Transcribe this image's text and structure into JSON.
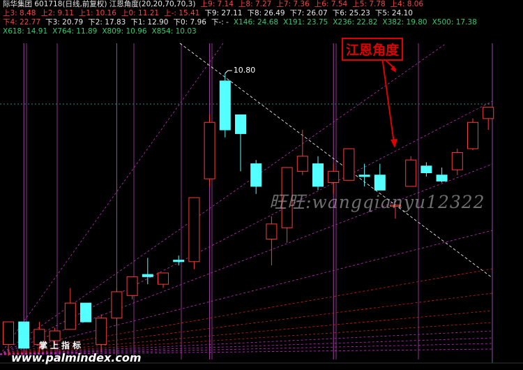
{
  "header": {
    "row1": [
      {
        "text": "际华集团 601718(日线,前复权) 江恩角度(20,20,70,70,3)",
        "color": "#e8e8e8"
      },
      {
        "text": "上9: 7.14",
        "color": "#ff4040"
      },
      {
        "text": "上8: 7.27",
        "color": "#ff4040"
      },
      {
        "text": "上7: 7.36",
        "color": "#ff4040"
      },
      {
        "text": "上6: 7.54",
        "color": "#ff4040"
      },
      {
        "text": "上5: 7.78",
        "color": "#ff4040"
      },
      {
        "text": "上4: 8.06",
        "color": "#ff4040"
      }
    ],
    "row2": [
      {
        "text": "上3: 8.48",
        "color": "#ff4040"
      },
      {
        "text": "上2: 9.11",
        "color": "#ff4040"
      },
      {
        "text": "上1: 10.16",
        "color": "#ff4040"
      },
      {
        "text": "上0: 11.21",
        "color": "#ff4040"
      },
      {
        "text": "上-: 15.41",
        "color": "#ff4040"
      },
      {
        "text": "下9: 27.11",
        "color": "#e8e8e8"
      },
      {
        "text": "下8: 26.49",
        "color": "#e8e8e8"
      },
      {
        "text": "下7: 26.07",
        "color": "#e8e8e8"
      },
      {
        "text": "下6: 25.23",
        "color": "#e8e8e8"
      },
      {
        "text": "下5: 24.10",
        "color": "#e8e8e8"
      }
    ],
    "row3": [
      {
        "text": "下4: 22.77",
        "color": "#ff4040"
      },
      {
        "text": "下3: 20.79",
        "color": "#e8e8e8"
      },
      {
        "text": "下2: 17.83",
        "color": "#e8e8e8"
      },
      {
        "text": "下1: 12.90",
        "color": "#e8e8e8"
      },
      {
        "text": "下0: 7.96",
        "color": "#e8e8e8"
      },
      {
        "text": "下-: -",
        "color": "#e8e8e8"
      },
      {
        "text": "X146: 24.68",
        "color": "#2ecc71"
      },
      {
        "text": "X191: 23.75",
        "color": "#2ecc71"
      },
      {
        "text": "X236: 22.82",
        "color": "#2ecc71"
      },
      {
        "text": "X382: 19.80",
        "color": "#2ecc71"
      },
      {
        "text": "X500: 17.38",
        "color": "#2ecc71"
      }
    ],
    "row4": [
      {
        "text": "X618: 14.91",
        "color": "#2ecc71"
      },
      {
        "text": "X764: 11.89",
        "color": "#2ecc71"
      },
      {
        "text": "X809: 10.96",
        "color": "#2ecc71"
      },
      {
        "text": "X854: 10.03",
        "color": "#2ecc71"
      }
    ]
  },
  "annotation_label": "江恩角度",
  "watermark": "旺旺:wangqianyu12322",
  "brand_text": "掌上指标",
  "site_text": "www.palmindex.com",
  "colors": {
    "up": "#ff3a3a",
    "down": "#54ffff",
    "gann_fan": "#c030c0",
    "gann_low": "#d02020",
    "vline": "#b040b0",
    "dash_line": "#ffffff",
    "grid": "#2a8a8a"
  },
  "chart_data": {
    "type": "candlestick",
    "high_label": "10.80",
    "ylim": [
      7.0,
      11.2
    ],
    "vertical_line_bars": [
      1,
      7,
      13,
      21
    ],
    "candles": [
      {
        "o": 7.2,
        "h": 7.45,
        "l": 7.05,
        "c": 7.5
      },
      {
        "o": 7.5,
        "h": 7.5,
        "l": 7.15,
        "c": 7.15
      },
      {
        "o": 7.2,
        "h": 7.5,
        "l": 7.1,
        "c": 7.4
      },
      {
        "o": 7.25,
        "h": 7.42,
        "l": 7.2,
        "c": 7.38
      },
      {
        "o": 7.4,
        "h": 7.95,
        "l": 7.4,
        "c": 7.75
      },
      {
        "o": 7.75,
        "h": 7.75,
        "l": 7.5,
        "c": 7.5
      },
      {
        "o": 7.2,
        "h": 7.6,
        "l": 7.1,
        "c": 7.55
      },
      {
        "o": 7.55,
        "h": 7.95,
        "l": 7.45,
        "c": 7.9
      },
      {
        "o": 7.85,
        "h": 8.1,
        "l": 7.8,
        "c": 8.1
      },
      {
        "o": 8.13,
        "h": 8.35,
        "l": 8.0,
        "c": 8.1
      },
      {
        "o": 8.0,
        "h": 8.15,
        "l": 7.95,
        "c": 8.15
      },
      {
        "o": 8.32,
        "h": 8.38,
        "l": 8.25,
        "c": 8.3
      },
      {
        "o": 8.3,
        "h": 8.88,
        "l": 8.2,
        "c": 9.15
      },
      {
        "o": 9.4,
        "h": 10.25,
        "l": 9.3,
        "c": 10.15
      },
      {
        "o": 10.7,
        "h": 10.8,
        "l": 9.95,
        "c": 10.05
      },
      {
        "o": 10.25,
        "h": 10.25,
        "l": 9.5,
        "c": 10.0
      },
      {
        "o": 9.6,
        "h": 9.65,
        "l": 9.2,
        "c": 9.3
      },
      {
        "o": 8.6,
        "h": 8.9,
        "l": 8.25,
        "c": 8.8
      },
      {
        "o": 8.75,
        "h": 9.55,
        "l": 8.55,
        "c": 9.55
      },
      {
        "o": 9.5,
        "h": 10.05,
        "l": 9.45,
        "c": 9.7
      },
      {
        "o": 9.6,
        "h": 9.7,
        "l": 9.25,
        "c": 9.3
      },
      {
        "o": 9.35,
        "h": 9.6,
        "l": 9.2,
        "c": 9.5
      },
      {
        "o": 9.38,
        "h": 9.75,
        "l": 9.4,
        "c": 9.8
      },
      {
        "o": 9.45,
        "h": 9.6,
        "l": 9.3,
        "c": 9.43
      },
      {
        "o": 9.45,
        "h": 9.6,
        "l": 9.25,
        "c": 9.25
      },
      {
        "o": 9.05,
        "h": 9.05,
        "l": 8.87,
        "c": 9.05
      },
      {
        "o": 9.3,
        "h": 9.7,
        "l": 9.3,
        "c": 9.65
      },
      {
        "o": 9.57,
        "h": 9.62,
        "l": 9.43,
        "c": 9.48
      },
      {
        "o": 9.45,
        "h": 9.55,
        "l": 9.35,
        "c": 9.37
      },
      {
        "o": 9.52,
        "h": 9.8,
        "l": 9.45,
        "c": 9.75
      },
      {
        "o": 9.8,
        "h": 10.2,
        "l": 9.78,
        "c": 10.15
      },
      {
        "o": 10.2,
        "h": 10.35,
        "l": 10.05,
        "c": 10.35
      }
    ]
  }
}
